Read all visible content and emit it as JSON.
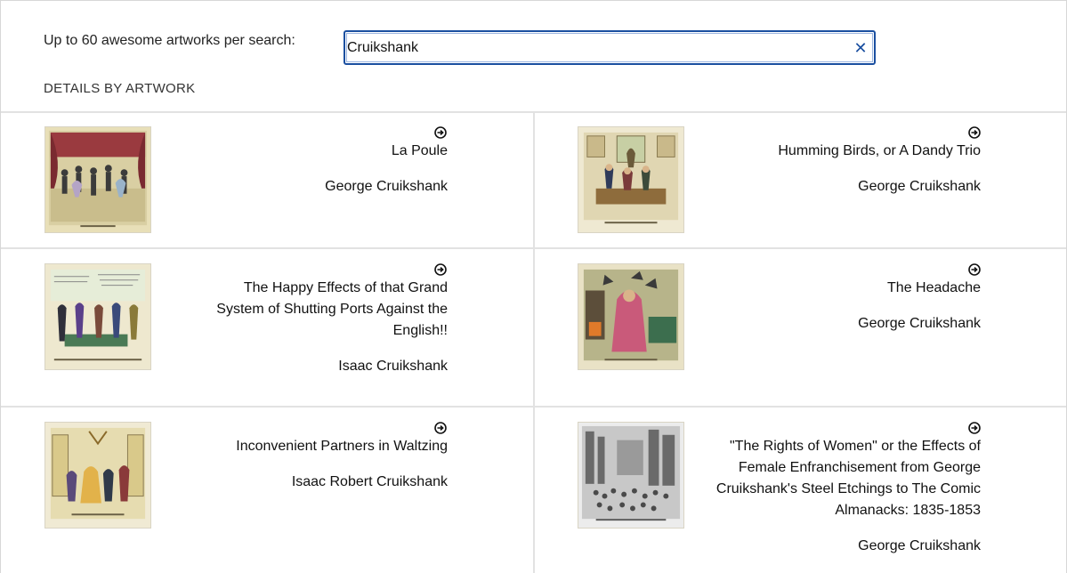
{
  "search": {
    "label": "Up to 60 awesome artworks per search:",
    "value": "Cruikshank",
    "clear_icon": "close-icon"
  },
  "section_title": "DETAILS BY ARTWORK",
  "artworks": [
    {
      "title": "La Poule",
      "artist": "George Cruikshank",
      "icon": "arrow-circle-right-icon"
    },
    {
      "title": "Humming Birds, or A Dandy Trio",
      "artist": "George Cruikshank",
      "icon": "arrow-circle-right-icon"
    },
    {
      "title": "The Happy Effects of that Grand System of Shutting Ports Against the English!!",
      "artist": "Isaac Cruikshank",
      "icon": "arrow-circle-right-icon"
    },
    {
      "title": "The Headache",
      "artist": "George Cruikshank",
      "icon": "arrow-circle-right-icon"
    },
    {
      "title": "Inconvenient Partners in Waltzing",
      "artist": "Isaac Robert Cruikshank",
      "icon": "arrow-circle-right-icon"
    },
    {
      "title": "\"The Rights of Women\" or the Effects of Female Enfranchisement from George Cruikshank's Steel Etchings to The Comic Almanacks: 1835-1853",
      "artist": "George Cruikshank",
      "icon": "arrow-circle-right-icon"
    }
  ]
}
